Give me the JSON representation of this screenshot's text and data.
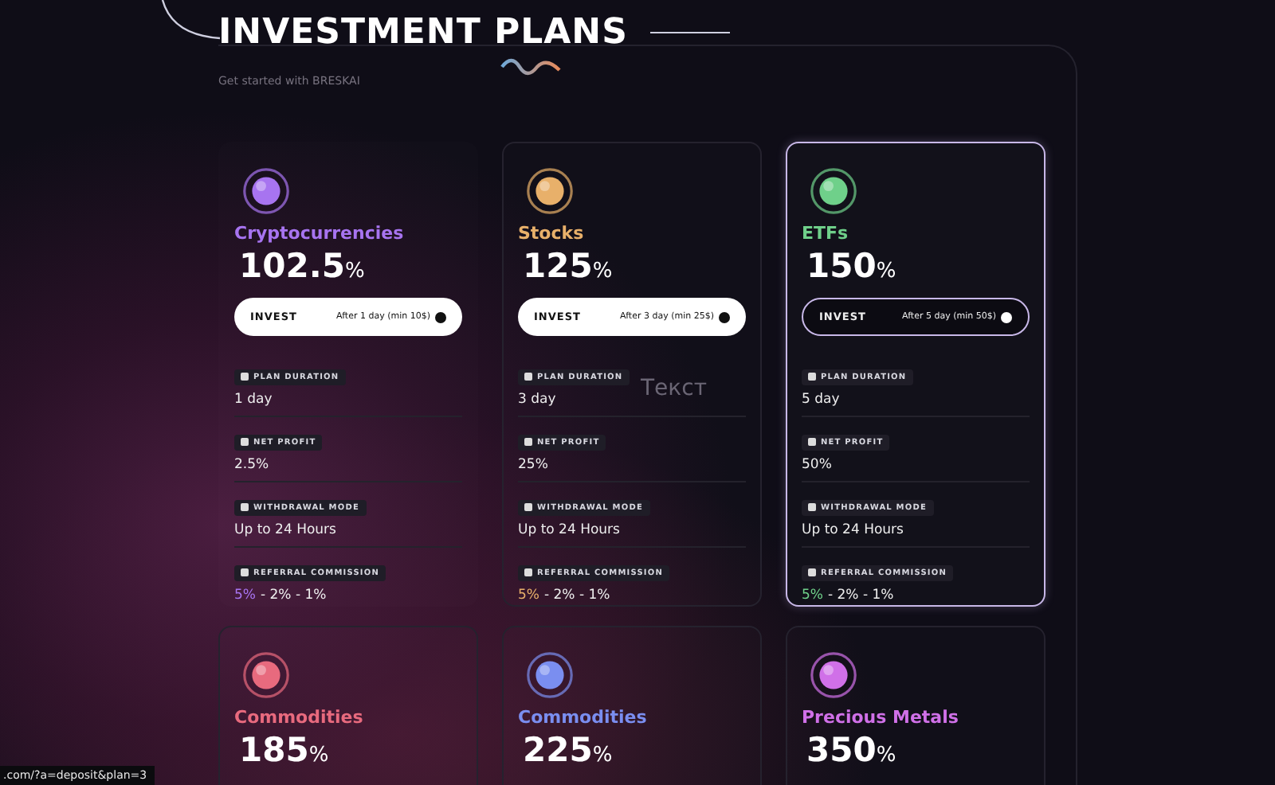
{
  "header": {
    "title": "INVESTMENT PLANS",
    "subtitle": "Get started with BRESKAI"
  },
  "stray_text": "Текст",
  "plans": [
    {
      "name": "Cryptocurrencies",
      "color": "#a774f0",
      "rate": "102.5",
      "unit": "%",
      "selected": false,
      "invest": {
        "label": "INVEST",
        "note": "After 1 day (min 10$)"
      },
      "details": [
        {
          "label": "PLAN DURATION",
          "value": "1 day"
        },
        {
          "label": "NET PROFIT",
          "value": "2.5%"
        },
        {
          "label": "WITHDRAWAL MODE",
          "value": "Up to 24 Hours"
        },
        {
          "label": "REFERRAL COMMISSION",
          "highlight": "5%",
          "value": "- 2% - 1%"
        }
      ]
    },
    {
      "name": "Stocks",
      "color": "#e8b06a",
      "rate": "125",
      "unit": "%",
      "selected": false,
      "invest": {
        "label": "INVEST",
        "note": "After 3 day (min 25$)"
      },
      "details": [
        {
          "label": "PLAN DURATION",
          "value": "3 day"
        },
        {
          "label": "NET PROFIT",
          "value": "25%"
        },
        {
          "label": "WITHDRAWAL MODE",
          "value": "Up to 24 Hours"
        },
        {
          "label": "REFERRAL COMMISSION",
          "highlight": "5%",
          "value": "- 2% - 1%"
        }
      ]
    },
    {
      "name": "ETFs",
      "color": "#6fd08a",
      "rate": "150",
      "unit": "%",
      "selected": true,
      "invest": {
        "label": "INVEST",
        "note": "After 5 day (min 50$)"
      },
      "details": [
        {
          "label": "PLAN DURATION",
          "value": "5 day"
        },
        {
          "label": "NET PROFIT",
          "value": "50%"
        },
        {
          "label": "WITHDRAWAL MODE",
          "value": "Up to 24 Hours"
        },
        {
          "label": "REFERRAL COMMISSION",
          "highlight": "5%",
          "value": "- 2% - 1%"
        }
      ]
    },
    {
      "name": "Commodities",
      "color": "#e86a7e",
      "rate": "185",
      "unit": "%",
      "selected": false
    },
    {
      "name": "Commodities",
      "color": "#7a8ef0",
      "rate": "225",
      "unit": "%",
      "selected": false
    },
    {
      "name": "Precious Metals",
      "color": "#d070e8",
      "rate": "350",
      "unit": "%",
      "selected": false
    }
  ],
  "status_bar": {
    "url": ".com/?a=deposit&plan=3"
  }
}
